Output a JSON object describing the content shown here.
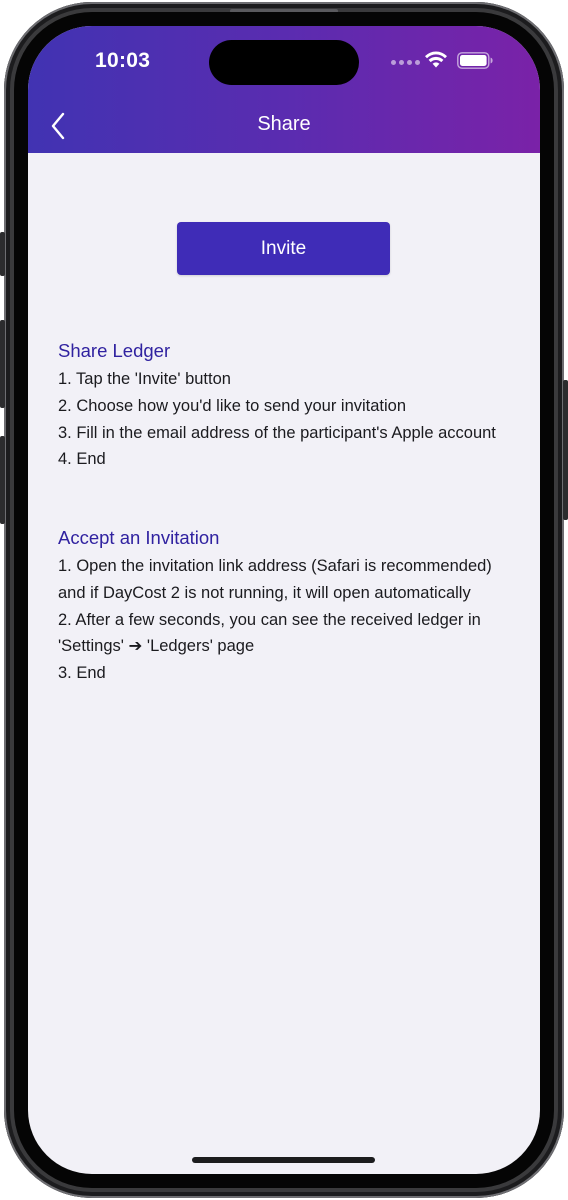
{
  "status_bar": {
    "time": "10:03",
    "icons": [
      "cellular-dots-icon",
      "wifi-icon",
      "battery-icon"
    ]
  },
  "nav": {
    "title": "Share",
    "back_icon": "chevron-left-icon"
  },
  "invite_button": {
    "label": "Invite"
  },
  "share_section": {
    "title": "Share Ledger",
    "steps": [
      "1. Tap the 'Invite' button",
      "2. Choose how you'd like to send your invitation",
      "3. Fill in the email address of the participant's Apple account",
      "4. End"
    ]
  },
  "accept_section": {
    "title": "Accept an Invitation",
    "steps": [
      "1. Open the invitation link address (Safari is recommended) and if DayCost 2 is not running, it will open automatically",
      "2. After a few seconds, you can see the received ledger in 'Settings' ➔ 'Ledgers' page",
      "3. End"
    ]
  },
  "colors": {
    "header_gradient_start": "#4133b2",
    "header_gradient_end": "#7a22a8",
    "accent": "#3f2cb7",
    "section_title": "#3022a0",
    "background": "#f2f1f7"
  }
}
